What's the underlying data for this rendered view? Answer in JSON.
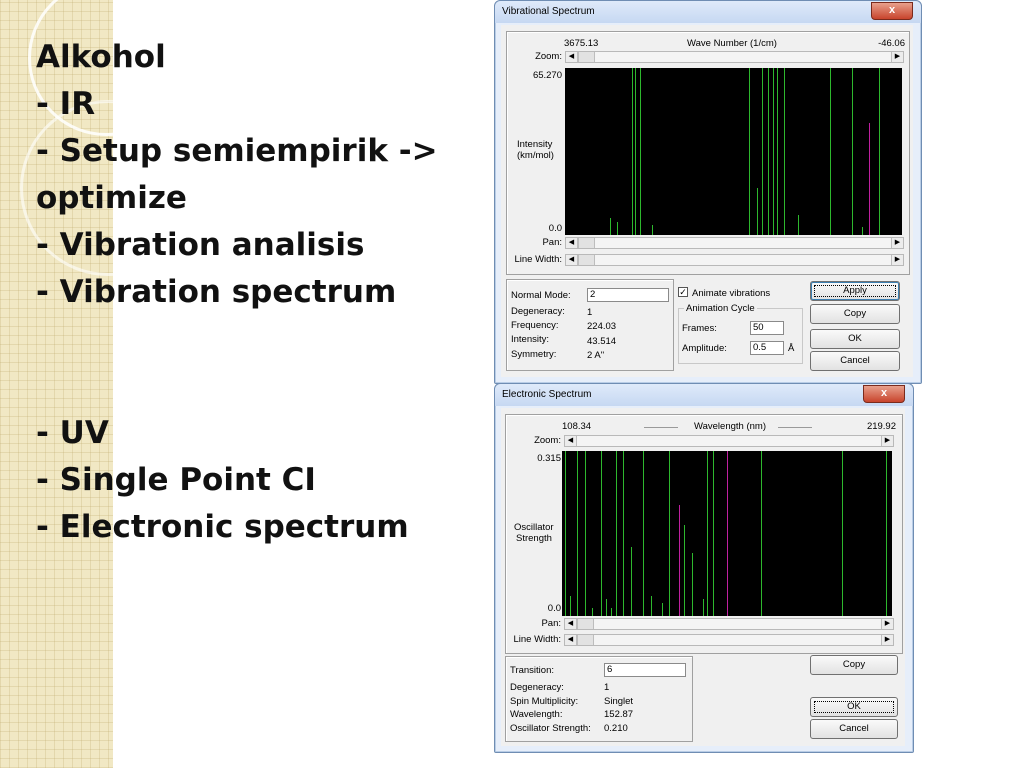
{
  "slide": {
    "lines": [
      "Alkohol",
      "- IR",
      "- Setup semiempirik ->",
      "optimize",
      "- Vibration analisis",
      "- Vibration spectrum",
      "- UV",
      "- Single Point CI",
      "- Electronic spectrum"
    ]
  },
  "vibrational": {
    "title": "Vibrational Spectrum",
    "axis_left": "3675.13",
    "axis_title": "Wave Number (1/cm)",
    "axis_right": "-46.06",
    "zoom_label": "Zoom:",
    "ymax": "65.270",
    "ymin": "0.0",
    "ylabel_1": "Intensity",
    "ylabel_2": "(km/mol)",
    "pan_label": "Pan:",
    "linewidth_label": "Line Width:",
    "normal_mode_label": "Normal Mode:",
    "normal_mode_value": "2",
    "degeneracy_label": "Degeneracy:",
    "degeneracy_value": "1",
    "frequency_label": "Frequency:",
    "frequency_value": "224.03",
    "intensity_label": "Intensity:",
    "intensity_value": "43.514",
    "symmetry_label": "Symmetry:",
    "symmetry_value": "2 A\"",
    "animate_label": "Animate vibrations",
    "animate_checked": true,
    "animation_cycle_label": "Animation Cycle",
    "frames_label": "Frames:",
    "frames_value": "50",
    "amplitude_label": "Amplitude:",
    "amplitude_value": "0.5",
    "amplitude_unit": "Å",
    "apply_label": "Apply",
    "copy_label": "Copy",
    "ok_label": "OK",
    "cancel_label": "Cancel",
    "close_label": "x",
    "colors": {
      "peak": "#2db82d",
      "selected": "#c020a0",
      "plot_bg": "#000000"
    },
    "peaks": [
      {
        "x": 0.135,
        "h": 0.1
      },
      {
        "x": 0.155,
        "h": 0.08
      },
      {
        "x": 0.2,
        "h": 1.0
      },
      {
        "x": 0.208,
        "h": 1.0
      },
      {
        "x": 0.222,
        "h": 1.0
      },
      {
        "x": 0.26,
        "h": 0.06
      },
      {
        "x": 0.548,
        "h": 1.0
      },
      {
        "x": 0.572,
        "h": 0.28
      },
      {
        "x": 0.585,
        "h": 1.0
      },
      {
        "x": 0.605,
        "h": 1.0
      },
      {
        "x": 0.618,
        "h": 1.0
      },
      {
        "x": 0.63,
        "h": 1.0
      },
      {
        "x": 0.652,
        "h": 1.0
      },
      {
        "x": 0.692,
        "h": 0.12
      },
      {
        "x": 0.79,
        "h": 1.0
      },
      {
        "x": 0.855,
        "h": 1.0
      },
      {
        "x": 0.885,
        "h": 0.05
      },
      {
        "x": 0.935,
        "h": 1.0
      },
      {
        "x": 0.905,
        "h": 0.67,
        "selected": true
      }
    ]
  },
  "electronic": {
    "title": "Electronic Spectrum",
    "axis_left": "108.34",
    "axis_title": "Wavelength (nm)",
    "axis_right": "219.92",
    "zoom_label": "Zoom:",
    "ymax": "0.315",
    "ymin": "0.0",
    "ylabel_1": "Oscillator",
    "ylabel_2": "Strength",
    "pan_label": "Pan:",
    "linewidth_label": "Line Width:",
    "transition_label": "Transition:",
    "transition_value": "6",
    "degeneracy_label": "Degeneracy:",
    "degeneracy_value": "1",
    "spin_label": "Spin Multiplicity:",
    "spin_value": "Singlet",
    "wavelength_label": "Wavelength:",
    "wavelength_value": "152.87",
    "osc_label": "Oscillator Strength:",
    "osc_value": "0.210",
    "copy_label": "Copy",
    "ok_label": "OK",
    "cancel_label": "Cancel",
    "close_label": "x",
    "colors": {
      "peak": "#2db82d",
      "selected": "#c020a0",
      "plot_bg": "#000000"
    },
    "peaks": [
      {
        "x": 0.01,
        "h": 1.0
      },
      {
        "x": 0.025,
        "h": 0.12
      },
      {
        "x": 0.045,
        "h": 1.0
      },
      {
        "x": 0.07,
        "h": 1.0
      },
      {
        "x": 0.09,
        "h": 0.05
      },
      {
        "x": 0.12,
        "h": 1.0
      },
      {
        "x": 0.135,
        "h": 0.1
      },
      {
        "x": 0.15,
        "h": 0.05
      },
      {
        "x": 0.165,
        "h": 1.0
      },
      {
        "x": 0.185,
        "h": 1.0
      },
      {
        "x": 0.21,
        "h": 0.42
      },
      {
        "x": 0.245,
        "h": 1.0
      },
      {
        "x": 0.27,
        "h": 0.12
      },
      {
        "x": 0.305,
        "h": 0.08
      },
      {
        "x": 0.325,
        "h": 1.0
      },
      {
        "x": 0.37,
        "h": 0.55
      },
      {
        "x": 0.395,
        "h": 0.38
      },
      {
        "x": 0.43,
        "h": 0.1
      },
      {
        "x": 0.44,
        "h": 1.0
      },
      {
        "x": 0.46,
        "h": 1.0
      },
      {
        "x": 0.605,
        "h": 1.0
      },
      {
        "x": 0.85,
        "h": 1.0
      },
      {
        "x": 0.985,
        "h": 1.0
      },
      {
        "x": 0.5,
        "h": 1.0,
        "selected": true
      },
      {
        "x": 0.355,
        "h": 0.67,
        "selected": true
      }
    ]
  }
}
